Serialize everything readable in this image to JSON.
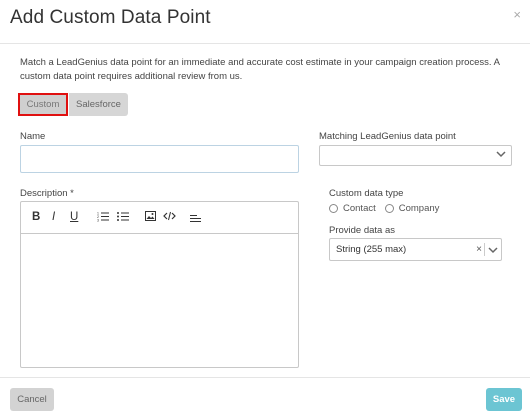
{
  "modal": {
    "title": "Add Custom Data Point",
    "close_label": "×",
    "intro": "Match a LeadGenius data point for an immediate and accurate cost estimate in your campaign creation process. A custom data point requires additional review from us."
  },
  "segmented": {
    "custom_label": "Custom",
    "salesforce_label": "Salesforce",
    "selected": "Custom"
  },
  "form": {
    "name_label": "Name",
    "name_value": "",
    "matching_label": "Matching LeadGenius data point",
    "matching_value": "",
    "description_label": "Description *",
    "toolbar": {
      "bold": "B",
      "italic": "I",
      "underline": "U"
    },
    "custom_type_label": "Custom data type",
    "custom_type_options": [
      "Contact",
      "Company"
    ],
    "provide_label": "Provide data as",
    "provide_value": "String (255 max)",
    "clear_label": "×"
  },
  "footer": {
    "cancel_label": "Cancel",
    "save_label": "Save"
  },
  "colors": {
    "accent": "#6cc5d3",
    "highlight_border": "#e01010"
  }
}
